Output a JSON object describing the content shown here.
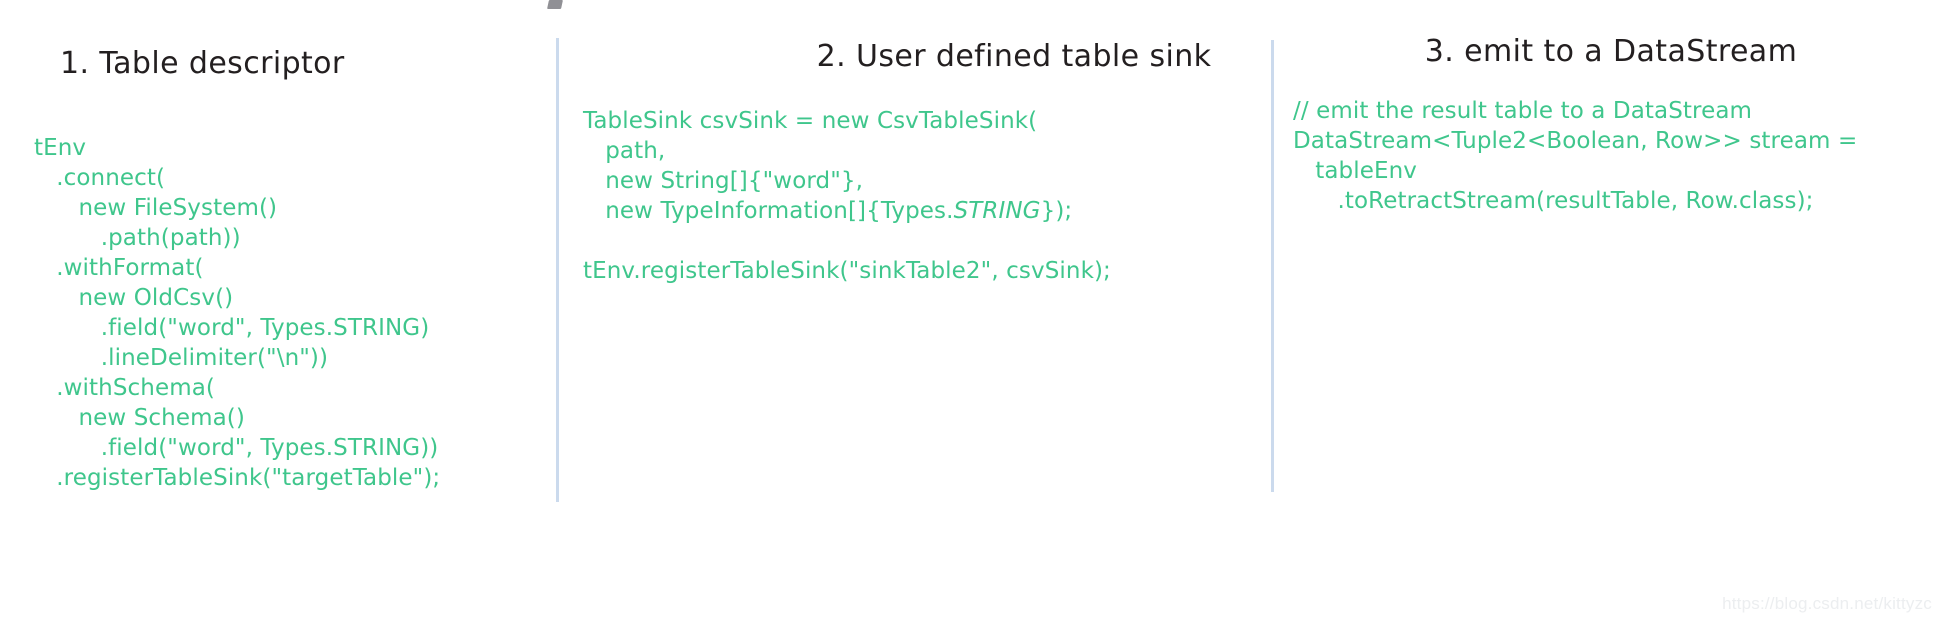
{
  "slide": {
    "background_color": "#ffffff",
    "code_color": "#3fc68c",
    "heading_color": "#231f20",
    "divider_color": "#c8d8ec"
  },
  "columns": [
    {
      "heading": "1. Table descriptor",
      "code_lines": [
        "tEnv",
        "   .connect(",
        "      new FileSystem()",
        "         .path(path))",
        "   .withFormat(",
        "      new OldCsv()",
        "         .field(\"word\", Types.STRING)",
        "         .lineDelimiter(\"\\n\"))",
        "   .withSchema(",
        "      new Schema()",
        "         .field(\"word\", Types.STRING))",
        "   .registerTableSink(\"targetTable\");"
      ]
    },
    {
      "heading": "2. User defined table sink",
      "code_lines": [
        "TableSink csvSink = new CsvTableSink(",
        "   path,",
        "   new String[]{\"word\"},",
        "   new TypeInformation[]{Types.STRING});",
        "",
        "tEnv.registerTableSink(\"sinkTable2\", csvSink);"
      ],
      "italic_segments": [
        "STRING"
      ]
    },
    {
      "heading": "3. emit to a DataStream",
      "code_lines": [
        "// emit the result table to a DataStream",
        "DataStream<Tuple2<Boolean, Row>> stream =",
        "   tableEnv",
        "      .toRetractStream(resultTable, Row.class);"
      ]
    }
  ],
  "watermark": "https://blog.csdn.net/kittyzc"
}
